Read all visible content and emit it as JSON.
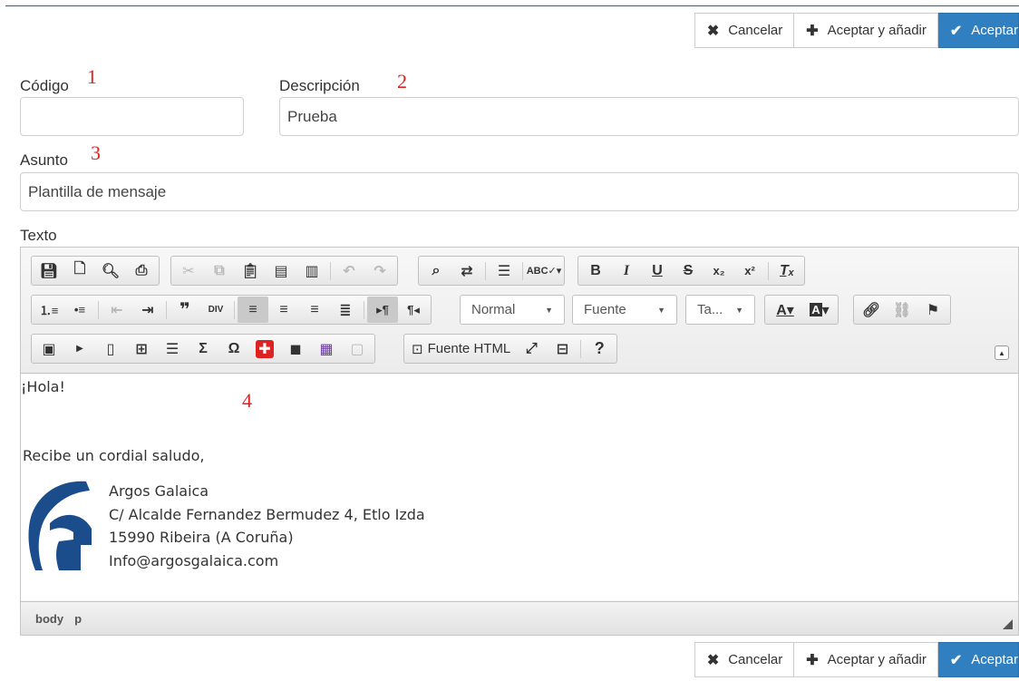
{
  "buttons": {
    "cancel": "Cancelar",
    "accept_add": "Aceptar y añadir",
    "accept": "Aceptar"
  },
  "form": {
    "code": {
      "label": "Código",
      "value": ""
    },
    "description": {
      "label": "Descripción",
      "value": "Prueba"
    },
    "subject": {
      "label": "Asunto",
      "value": "Plantilla de mensaje"
    },
    "text": {
      "label": "Texto"
    }
  },
  "annotations": [
    "1",
    "2",
    "3",
    "4"
  ],
  "toolbar": {
    "format_combo": "Normal",
    "font_combo": "Fuente",
    "size_combo": "Ta...",
    "source_button": "Fuente HTML"
  },
  "editor_content": {
    "greeting": "¡Hola!",
    "closing": "Recibe un cordial saludo,",
    "signature": [
      "Argos Galaica",
      "C/ Alcalde Fernandez Bermudez 4, Etlo Izda",
      "15990 Ribeira (A Coruña)",
      "Info@argosgalaica.com"
    ]
  },
  "statusbar": [
    "body",
    "p"
  ],
  "colors": {
    "primary": "#2f7fc1",
    "annotation": "#dd2222",
    "logo": "#1b4d8c"
  }
}
